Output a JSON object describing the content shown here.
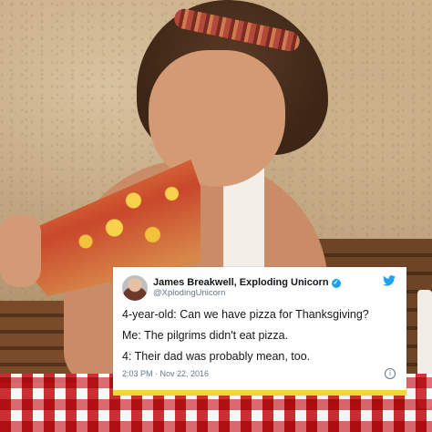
{
  "tweet": {
    "display_name": "James Breakwell, Exploding Unicorn",
    "handle": "@XplodingUnicorn",
    "verified_icon": "verified-badge-icon",
    "brand_icon": "twitter-bird-icon",
    "lines": [
      "4-year-old: Can we have pizza for Thanksgiving?",
      "Me: The pilgrims didn't eat pizza.",
      "4: Their dad was probably mean, too."
    ],
    "timestamp": "2:03 PM · Nov 22, 2016",
    "info_icon": "info-icon"
  },
  "colors": {
    "accent_border": "#f5d533",
    "twitter_blue": "#1da1f2",
    "text_primary": "#14171a",
    "text_secondary": "#657786"
  }
}
